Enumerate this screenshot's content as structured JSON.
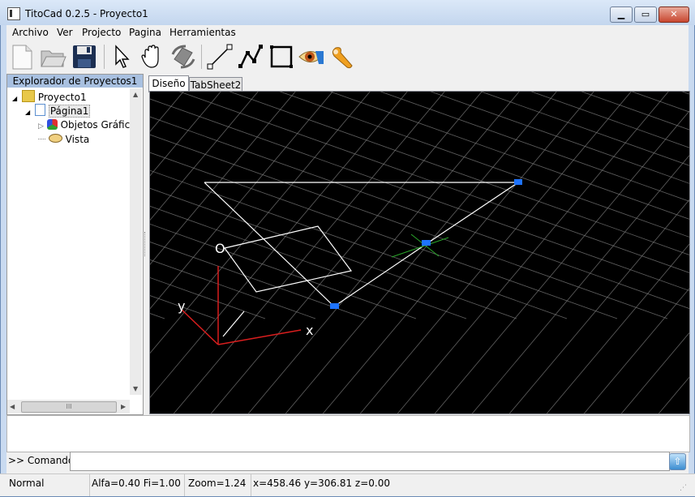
{
  "window": {
    "title": "TitoCad 0.2.5 - Proyecto1",
    "minimize_label": "▁",
    "maximize_label": "▭",
    "close_label": "✕"
  },
  "menu": {
    "items": [
      {
        "label": "Archivo"
      },
      {
        "label": "Ver"
      },
      {
        "label": "Projecto"
      },
      {
        "label": "Pagina"
      },
      {
        "label": "Herramientas"
      }
    ]
  },
  "toolbar": {
    "buttons": [
      {
        "icon": "new-document-icon"
      },
      {
        "icon": "open-folder-icon"
      },
      {
        "icon": "save-disk-icon"
      },
      {
        "icon": "select-arrow-icon"
      },
      {
        "icon": "pan-hand-icon"
      },
      {
        "icon": "rotate-cube-icon"
      },
      {
        "icon": "line-icon"
      },
      {
        "icon": "polyline-icon"
      },
      {
        "icon": "rectangle-icon"
      },
      {
        "icon": "view-eye-icon"
      },
      {
        "icon": "wrench-icon"
      }
    ]
  },
  "explorer": {
    "title": "Explorador de Proyectos1",
    "tree": [
      {
        "label": "Proyecto1",
        "level": 0,
        "expanded": true
      },
      {
        "label": "Página1",
        "level": 1,
        "expanded": true,
        "selected": true
      },
      {
        "label": "Objetos Gráfico",
        "level": 2,
        "expanded": false
      },
      {
        "label": "Vista",
        "level": 2
      }
    ],
    "hscroll_grip": "III"
  },
  "tabs": [
    {
      "label": "Diseño",
      "active": true
    },
    {
      "label": "TabSheet2",
      "active": false
    }
  ],
  "canvas": {
    "axis_labels": {
      "x": "x",
      "y": "y"
    },
    "grid_color": "#7a7a7a",
    "shape_color": "#ffffff",
    "handle_color": "#1e73ff",
    "cursor_color": "#2aa52a",
    "axis_x_color": "#d81e1e",
    "axis_y_color": "#d81e1e"
  },
  "command": {
    "prompt": ">> Comando:",
    "value": "",
    "execute_icon": "up-arrow-icon"
  },
  "status": {
    "mode": "Normal",
    "angles": "Alfa=0.40 Fi=1.00",
    "zoom": "Zoom=1.24",
    "coords": "x=458.46 y=306.81 z=0.00"
  }
}
